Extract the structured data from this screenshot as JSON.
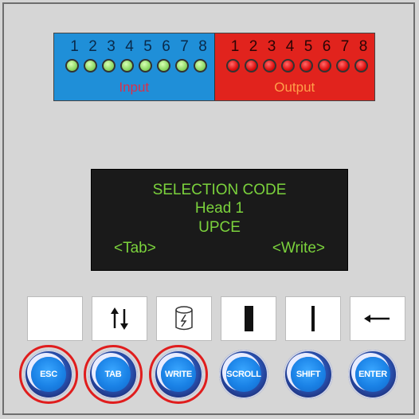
{
  "io": {
    "numbers": [
      "1",
      "2",
      "3",
      "4",
      "5",
      "6",
      "7",
      "8"
    ],
    "input_label": "Input",
    "output_label": "Output",
    "input_color": "#1f8fd8",
    "output_color": "#e1231d",
    "input_led_color": "#8dd864",
    "output_led_color": "#e01010"
  },
  "lcd": {
    "line1": "SELECTION CODE",
    "line2": "Head 1",
    "line3": "UPCE",
    "left_softkey": "<Tab>",
    "right_softkey": "<Write>",
    "text_color": "#7bd23c"
  },
  "key_icons": [
    "blank",
    "up-down-arrows-icon",
    "cylinder-bolt-icon",
    "thick-bar-icon",
    "thin-bar-icon",
    "return-arrow-icon"
  ],
  "buttons": [
    {
      "label": "ESC",
      "highlighted": true
    },
    {
      "label": "TAB",
      "highlighted": true
    },
    {
      "label": "WRITE",
      "highlighted": true
    },
    {
      "label": "SCROLL",
      "highlighted": false
    },
    {
      "label": "SHIFT",
      "highlighted": false
    },
    {
      "label": "ENTER",
      "highlighted": false
    }
  ],
  "highlight_color": "#e01d1d"
}
